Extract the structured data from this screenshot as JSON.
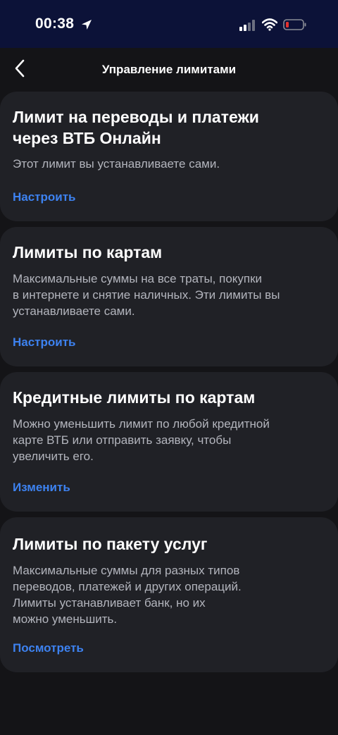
{
  "status_bar": {
    "time": "00:38"
  },
  "header": {
    "title": "Управление лимитами"
  },
  "cards": [
    {
      "title_line1": "Лимит на переводы и платежи",
      "title_line2": "через ВТБ Онлайн",
      "desc": [
        "Этот лимит вы устанавливаете сами."
      ],
      "action": "Настроить"
    },
    {
      "title_line1": "Лимиты по картам",
      "desc": [
        "Максимальные суммы на все траты, покупки",
        "в интернете и снятие наличных. Эти лимиты вы",
        "устанавливаете сами."
      ],
      "action": "Настроить"
    },
    {
      "title_line1": "Кредитные лимиты по картам",
      "desc": [
        "Можно уменьшить лимит по любой кредитной",
        "карте ВТБ или отправить заявку, чтобы",
        "увеличить его."
      ],
      "action": "Изменить"
    },
    {
      "title_line1": "Лимиты по пакету услуг",
      "desc": [
        "Максимальные суммы для разных типов",
        "переводов, платежей и других операций.",
        "Лимиты устанавливает банк, но их",
        "можно уменьшить."
      ],
      "action": "Посмотреть"
    }
  ],
  "icons": [
    "location-arrow-icon",
    "cellular-signal-icon",
    "wifi-icon",
    "battery-low-icon",
    "chevron-left-icon"
  ],
  "colors": {
    "accent": "#3d82f0",
    "background": "#141417",
    "card": "#202126",
    "status_bar": "#0c1238",
    "battery_low": "#e5322d"
  }
}
